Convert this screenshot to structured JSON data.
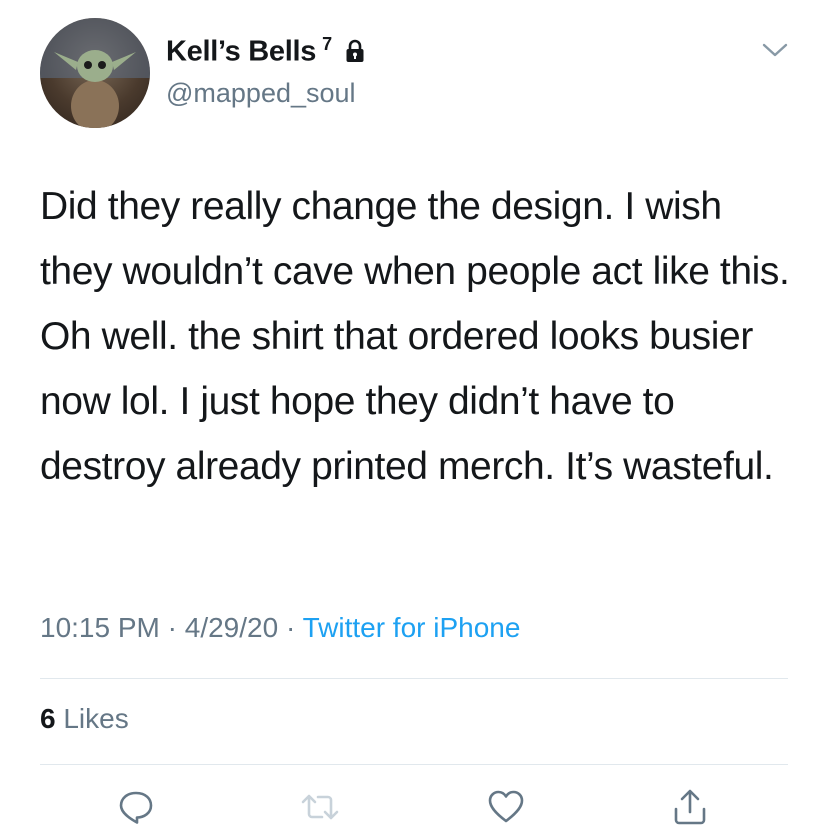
{
  "author": {
    "display_name": "Kell’s Bells",
    "badge": "7",
    "handle": "@mapped_soul",
    "lock_icon": "lock-icon",
    "avatar_icon": "baby-yoda-avatar"
  },
  "menu": {
    "icon": "chevron-down-icon"
  },
  "tweet": {
    "text": "Did they really change the design. I wish they wouldn’t cave when people act like this. Oh well. the shirt that ordered looks busier now lol. I just hope they didn’t have to destroy already printed merch. It’s wasteful."
  },
  "meta": {
    "time": "10:15 PM",
    "sep1": " · ",
    "date": "4/29/20",
    "sep2": " · ",
    "source": "Twitter for iPhone"
  },
  "stats": {
    "likes_count": "6",
    "likes_label": "Likes"
  },
  "actions": {
    "reply_icon": "reply-icon",
    "retweet_icon": "retweet-icon",
    "like_icon": "heart-icon",
    "share_icon": "share-icon"
  },
  "colors": {
    "text": "#14171a",
    "secondary": "#657786",
    "link": "#1da1f2",
    "divider": "#e1e8ed"
  }
}
